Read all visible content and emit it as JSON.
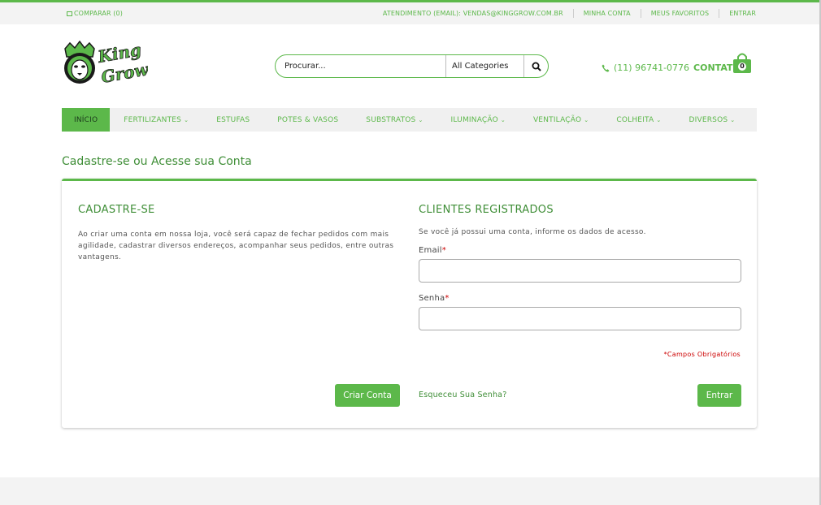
{
  "topbar": {
    "compare": "COMPARAR (0)",
    "links": [
      "ATENDIMENTO (EMAIL): VENDAS@KINGGROW.COM.BR",
      "MINHA CONTA",
      "MEUS FAVORITOS",
      "ENTRAR"
    ]
  },
  "header": {
    "logo_text_1": "King",
    "logo_text_2": "Grow",
    "search": {
      "placeholder": "Procurar...",
      "category": "All Categories"
    },
    "phone": "(11) 96741-0776",
    "contact_label": "CONTATO",
    "cart_count": "0"
  },
  "nav": [
    {
      "label": "INÍCIO",
      "caret": false
    },
    {
      "label": "FERTILIZANTES",
      "caret": true
    },
    {
      "label": "ESTUFAS",
      "caret": false
    },
    {
      "label": "POTES & VASOS",
      "caret": false
    },
    {
      "label": "SUBSTRATOS",
      "caret": true
    },
    {
      "label": "ILUMINAÇÃO",
      "caret": true
    },
    {
      "label": "VENTILAÇÃO",
      "caret": true
    },
    {
      "label": "COLHEITA",
      "caret": true
    },
    {
      "label": "DIVERSOS",
      "caret": true
    }
  ],
  "page_title": "Cadastre-se ou Acesse sua Conta",
  "register": {
    "heading": "CADASTRE-SE",
    "description": "Ao criar uma conta em nossa loja, você será capaz de fechar pedidos com mais agilidade, cadastrar diversos endereços, acompanhar seus pedidos, entre outras vantagens.",
    "button": "Criar Conta"
  },
  "login": {
    "heading": "CLIENTES REGISTRADOS",
    "description": "Se você já possui uma conta, informe os dados de acesso.",
    "email_label": "Email",
    "password_label": "Senha",
    "required_mark": "*",
    "email_value": "",
    "password_value": "",
    "required_note": "*Campos Obrigatórios",
    "forgot_link": "Esqueceu Sua Senha?",
    "submit": "Entrar"
  },
  "colors": {
    "brand_green": "#5cb84a",
    "dark_green": "#3f8e37",
    "required_red": "#cc0000"
  }
}
